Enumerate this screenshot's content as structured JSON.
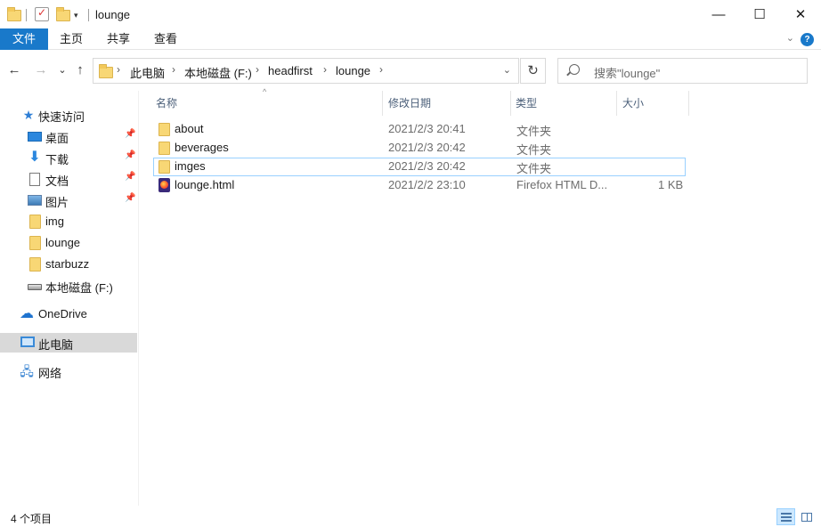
{
  "window": {
    "title": "lounge",
    "minimize_glyph": "—",
    "maximize_glyph": "☐",
    "close_glyph": "✕"
  },
  "ribbon": {
    "tabs": [
      "文件",
      "主页",
      "共享",
      "查看"
    ],
    "help_glyph": "?",
    "collapse_glyph": "⌄"
  },
  "navigation": {
    "back_glyph": "←",
    "forward_glyph": "→",
    "recent_glyph": "⌄",
    "up_glyph": "↑"
  },
  "address": {
    "breadcrumbs": [
      "此电脑",
      "本地磁盘 (F:)",
      "headfirst",
      "lounge"
    ],
    "separator": "›",
    "dropdown_glyph": "⌄",
    "refresh_glyph": "↻"
  },
  "search": {
    "placeholder": "搜索\"lounge\""
  },
  "nav_pane": {
    "quick_access": "快速访问",
    "pinned": [
      "桌面",
      "下载",
      "文档",
      "图片"
    ],
    "folders": [
      "img",
      "lounge",
      "starbuzz"
    ],
    "drive": "本地磁盘 (F:)",
    "onedrive": "OneDrive",
    "this_pc": "此电脑",
    "network": "网络",
    "pin_glyph": "📌"
  },
  "columns": {
    "name": "名称",
    "modified": "修改日期",
    "type": "类型",
    "size": "大小",
    "sort_glyph": "^"
  },
  "files": [
    {
      "name": "about",
      "modified": "2021/2/3 20:41",
      "type": "文件夹",
      "size": "",
      "icon": "folder-icon"
    },
    {
      "name": "beverages",
      "modified": "2021/2/3 20:42",
      "type": "文件夹",
      "size": "",
      "icon": "folder-icon"
    },
    {
      "name": "imges",
      "modified": "2021/2/3 20:42",
      "type": "文件夹",
      "size": "",
      "icon": "folder-icon"
    },
    {
      "name": "lounge.html",
      "modified": "2021/2/2 23:10",
      "type": "Firefox HTML D...",
      "size": "1 KB",
      "icon": "firefox-html-icon"
    }
  ],
  "status": {
    "item_count": "4 个项目"
  },
  "colors": {
    "accent": "#1979ca",
    "selection": "#d9d9d9",
    "focus_border": "#99d1ff"
  }
}
